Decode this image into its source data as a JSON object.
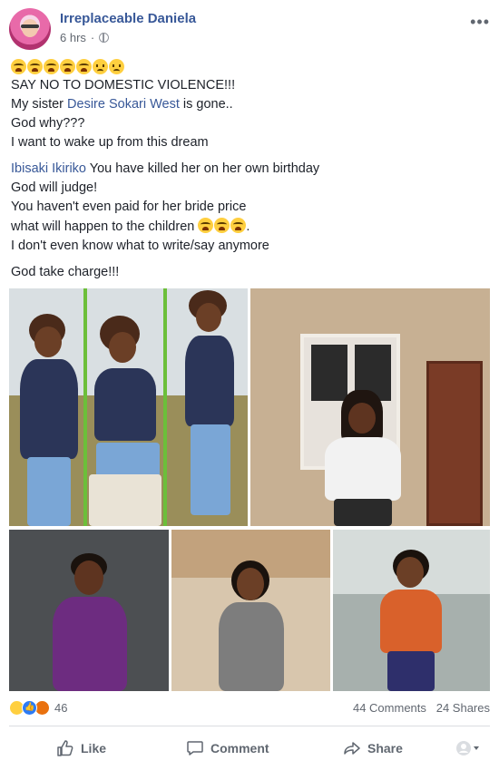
{
  "post": {
    "author": "Irreplaceable Daniela",
    "time": "6 hrs",
    "lines": {
      "l1": "SAY NO TO DOMESTIC VIOLENCE!!!",
      "l2_pre": "My sister ",
      "l2_link": "Desire Sokari West",
      "l2_post": " is gone..",
      "l3": "God why???",
      "l4": "I want to wake up from this dream",
      "l5_link": "Ibisaki Ikiriko",
      "l5_post": " You have killed her on her own birthday",
      "l6": "God will judge!",
      "l7": "You haven't even paid for her bride price",
      "l8": "what will happen to the children",
      "l8_end": ".",
      "l9": "I don't even know what to write/say anymore",
      "l10": "God take charge!!!"
    },
    "emoji_row": [
      "crying-face",
      "crying-face",
      "crying-face",
      "crying-face",
      "crying-face",
      "sad-face",
      "sad-face"
    ]
  },
  "stats": {
    "reaction_count": "46",
    "comments": "44 Comments",
    "shares": "24 Shares",
    "reactions": [
      "sad",
      "like",
      "angry"
    ]
  },
  "actions": {
    "like": "Like",
    "comment": "Comment",
    "share": "Share"
  },
  "colors": {
    "link": "#385898",
    "text": "#1d2129",
    "muted": "#616770"
  }
}
